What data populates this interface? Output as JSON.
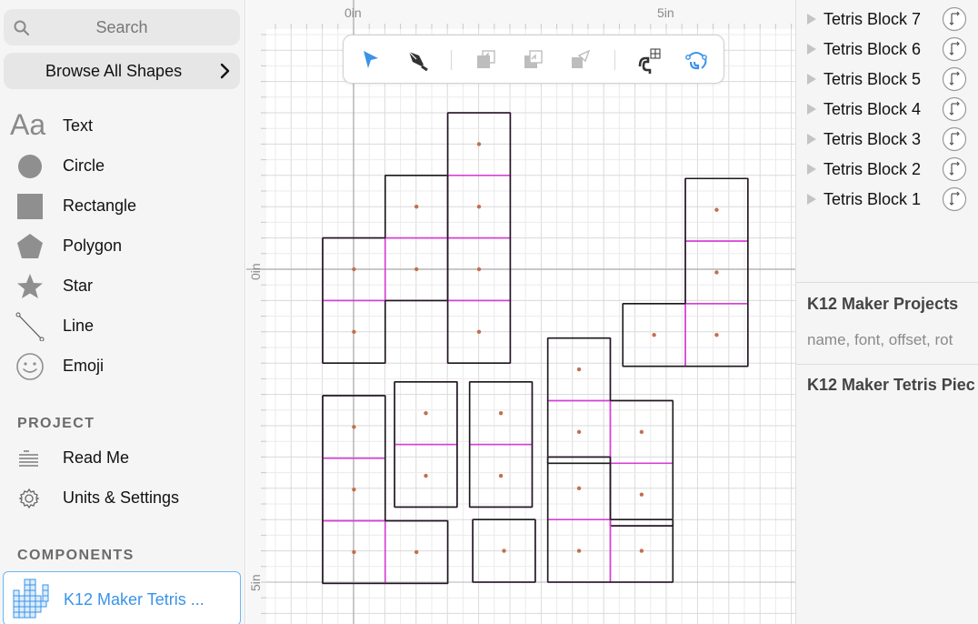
{
  "sidebar": {
    "search": {
      "placeholder": "Search"
    },
    "browse_label": "Browse All Shapes",
    "shapes": [
      {
        "label": "Text",
        "icon": "text-icon"
      },
      {
        "label": "Circle",
        "icon": "circle-icon"
      },
      {
        "label": "Rectangle",
        "icon": "rectangle-icon"
      },
      {
        "label": "Polygon",
        "icon": "polygon-icon"
      },
      {
        "label": "Star",
        "icon": "star-icon"
      },
      {
        "label": "Line",
        "icon": "line-icon"
      },
      {
        "label": "Emoji",
        "icon": "emoji-icon"
      }
    ],
    "text_icon_glyph": "Aa",
    "project_title": "PROJECT",
    "project_items": [
      {
        "label": "Read Me",
        "icon": "readme-icon"
      },
      {
        "label": "Units & Settings",
        "icon": "gear-icon"
      }
    ],
    "components_title": "COMPONENTS",
    "component": {
      "label": "K12 Maker Tetris ...",
      "icon": "tetris-component-icon"
    }
  },
  "canvas": {
    "ruler": {
      "x_zero": "0in",
      "x_five": "5in",
      "y_zero": "0in",
      "y_five": "5in"
    },
    "toolbar": [
      "select-arrow-icon",
      "pen-tool-icon",
      "bring-forward-icon",
      "send-backward-icon",
      "flip-icon",
      "snap-to-grid-icon",
      "snap-to-points-icon"
    ],
    "colors": {
      "block_border": "#1a1a1a",
      "cell_divider": "#d63ed6",
      "center_dot": "#c0704e",
      "grid_minor": "#ebebeb",
      "grid_major": "#dadada",
      "axis": "#b5b5b5",
      "accent": "#3a93e8"
    }
  },
  "layers": [
    {
      "label": "Tetris Block 7"
    },
    {
      "label": "Tetris Block 6"
    },
    {
      "label": "Tetris Block 5"
    },
    {
      "label": "Tetris Block 4"
    },
    {
      "label": "Tetris Block 3"
    },
    {
      "label": "Tetris Block 2"
    },
    {
      "label": "Tetris Block 1"
    }
  ],
  "inspector": {
    "section1_title": "K12 Maker Projects",
    "section1_sub": "name, font, offset, rot",
    "section2_title": "K12 Maker Tetris Piec"
  }
}
